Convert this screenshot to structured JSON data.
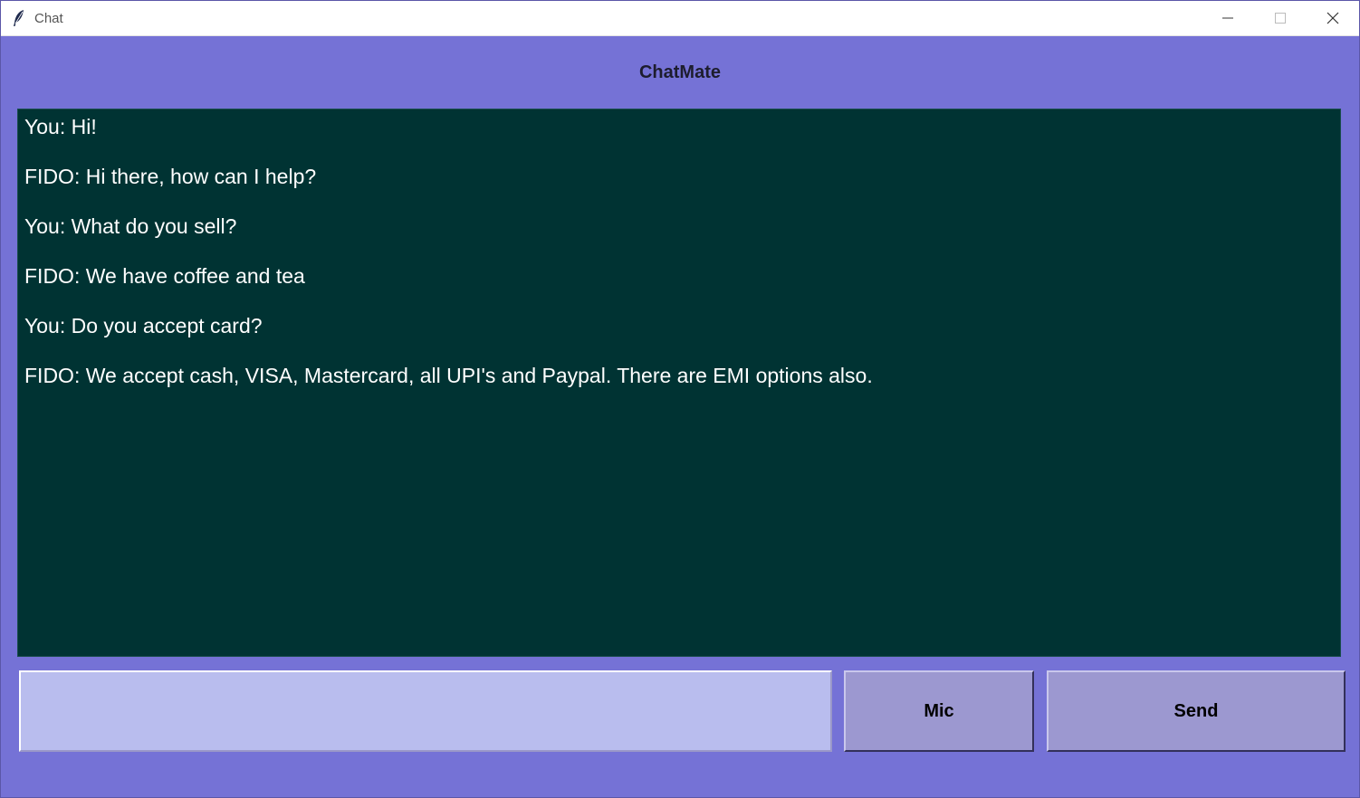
{
  "window": {
    "title": "Chat",
    "icon": "feather-icon"
  },
  "app": {
    "heading": "ChatMate"
  },
  "chat": {
    "messages": [
      "You: Hi!",
      "FIDO: Hi there, how can I help?",
      "You: What do you sell?",
      "FIDO: We have coffee and tea",
      "You: Do you accept card?",
      "FIDO: We accept cash, VISA, Mastercard, all UPI's and Paypal. There are EMI options also."
    ]
  },
  "input": {
    "value": "",
    "placeholder": ""
  },
  "buttons": {
    "mic_label": "Mic",
    "send_label": "Send"
  },
  "colors": {
    "background": "#7570d4",
    "chat_background": "#003333",
    "chat_text": "#ffffff",
    "input_background": "#b9bdee",
    "button_background": "#9c98d0"
  }
}
